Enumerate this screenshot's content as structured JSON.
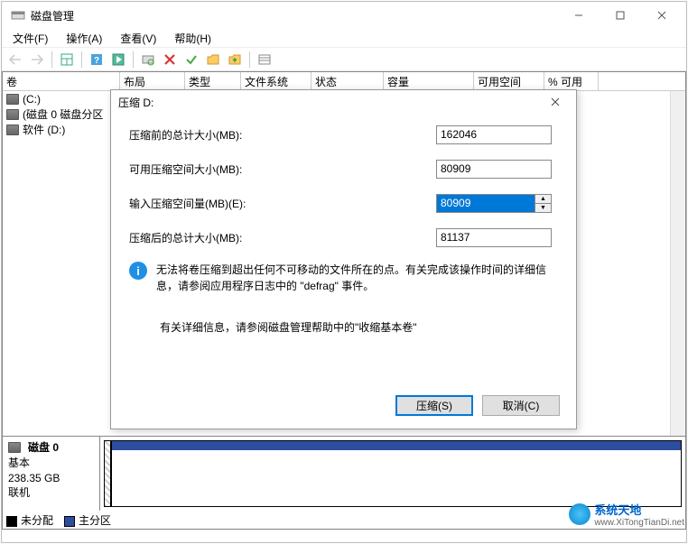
{
  "window": {
    "title": "磁盘管理",
    "controls": {
      "min": "—",
      "max": "☐",
      "close": "✕"
    }
  },
  "menu": {
    "file": "文件(F)",
    "action": "操作(A)",
    "view": "查看(V)",
    "help": "帮助(H)"
  },
  "columns": {
    "volume": "卷",
    "layout": "布局",
    "type": "类型",
    "filesystem": "文件系统",
    "status": "状态",
    "capacity": "容量",
    "free": "可用空间",
    "pctfree": "% 可用"
  },
  "volumes": {
    "v0": "(C:)",
    "v1": "(磁盘 0 磁盘分区",
    "v2": "软件 (D:)"
  },
  "disk": {
    "name": "磁盘 0",
    "type": "基本",
    "size": "238.35 GB",
    "status": "联机"
  },
  "legend": {
    "unalloc": "未分配",
    "primary": "主分区"
  },
  "dialog": {
    "title": "压缩 D:",
    "fields": {
      "total_before_label": "压缩前的总计大小(MB):",
      "total_before_value": "162046",
      "available_label": "可用压缩空间大小(MB):",
      "available_value": "80909",
      "enter_label": "输入压缩空间量(MB)(E):",
      "enter_value": "80909",
      "total_after_label": "压缩后的总计大小(MB):",
      "total_after_value": "81137"
    },
    "info_text": "无法将卷压缩到超出任何不可移动的文件所在的点。有关完成该操作时间的详细信息，请参阅应用程序日志中的 \"defrag\" 事件。",
    "help_text": "有关详细信息，请参阅磁盘管理帮助中的\"收缩基本卷\"",
    "btn_ok": "压缩(S)",
    "btn_cancel": "取消(C)"
  },
  "watermark": {
    "cn": "系统天地",
    "url": "www.XiTongTianDi.net"
  }
}
